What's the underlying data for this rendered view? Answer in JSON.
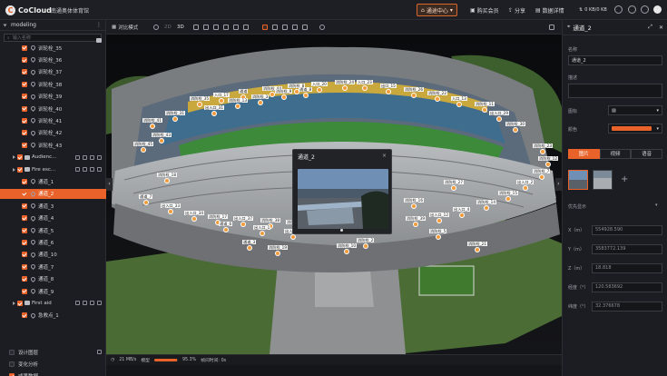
{
  "app": {
    "name": "CoCloud",
    "project_title": "南通奥体体育馆"
  },
  "topbar": {
    "scene_center": "通途中心",
    "buy_package": "购买会员",
    "share": "分享",
    "data_details": "数据详情",
    "network_speed": "0 KB/0 KB"
  },
  "sidebar": {
    "layer_title": "modeling",
    "search_placeholder": "输入名称",
    "rows": [
      {
        "label": "训轮栓_35",
        "kind": "pin",
        "checked": true
      },
      {
        "label": "训轮栓_36",
        "kind": "pin",
        "checked": true
      },
      {
        "label": "训轮栓_37",
        "kind": "pin",
        "checked": true
      },
      {
        "label": "训轮栓_38",
        "kind": "pin",
        "checked": true
      },
      {
        "label": "训轮栓_39",
        "kind": "pin",
        "checked": true
      },
      {
        "label": "训轮栓_40",
        "kind": "pin",
        "checked": true
      },
      {
        "label": "训轮栓_41",
        "kind": "pin",
        "checked": true
      },
      {
        "label": "训轮栓_42",
        "kind": "pin",
        "checked": true
      },
      {
        "label": "训轮栓_43",
        "kind": "pin",
        "checked": true
      },
      {
        "label": "Audienc...",
        "kind": "folder",
        "checked": true
      },
      {
        "label": "Fire esc...",
        "kind": "folder",
        "checked": true
      },
      {
        "label": "通道_1",
        "kind": "pin",
        "checked": true
      },
      {
        "label": "通道_2",
        "kind": "pin",
        "checked": true,
        "selected": true
      },
      {
        "label": "通道_3",
        "kind": "pin",
        "checked": true
      },
      {
        "label": "通道_4",
        "kind": "pin",
        "checked": true
      },
      {
        "label": "通道_5",
        "kind": "pin",
        "checked": true
      },
      {
        "label": "通道_6",
        "kind": "pin",
        "checked": true
      },
      {
        "label": "通道_10",
        "kind": "pin",
        "checked": true
      },
      {
        "label": "通道_7",
        "kind": "pin",
        "checked": true
      },
      {
        "label": "通道_8",
        "kind": "pin",
        "checked": true
      },
      {
        "label": "通道_9",
        "kind": "pin",
        "checked": true
      },
      {
        "label": "First aid",
        "kind": "folder",
        "checked": true
      },
      {
        "label": "急救点_1",
        "kind": "pin",
        "checked": true
      },
      {
        "label": "",
        "kind": "blank",
        "checked": false
      },
      {
        "label": "",
        "kind": "blank",
        "checked": false
      },
      {
        "label": "设计图层",
        "kind": "plain",
        "checked": false
      },
      {
        "label": "变化分析",
        "kind": "plain",
        "checked": false
      },
      {
        "label": "成果数据",
        "kind": "plain",
        "checked": true
      }
    ]
  },
  "view_toolbar": {
    "compare_mode": "对比模式",
    "mode_2d": "2D",
    "mode_3d": "3D"
  },
  "markers": [
    {
      "label": "消防栓_41"
    },
    {
      "label": "消防栓_31"
    },
    {
      "label": "消防栓_35"
    },
    {
      "label": "入口_17"
    },
    {
      "label": "通道"
    },
    {
      "label": "消防栓_44"
    },
    {
      "label": "消防栓_8"
    },
    {
      "label": "入口_20"
    },
    {
      "label": "消防栓_24"
    },
    {
      "label": "入口_23"
    },
    {
      "label": "出口_15"
    },
    {
      "label": "消防栓_26"
    },
    {
      "label": "消防栓_22"
    },
    {
      "label": "入口_13"
    },
    {
      "label": "消防栓_11"
    },
    {
      "label": "消防栓_45"
    },
    {
      "label": "消防栓_43"
    },
    {
      "label": "出入口_29"
    },
    {
      "label": "消防栓_30"
    },
    {
      "label": "出入口_31"
    },
    {
      "label": "消防栓_13"
    },
    {
      "label": "消防栓_3"
    },
    {
      "label": "消防栓_9"
    },
    {
      "label": "通道_8"
    },
    {
      "label": "通道_7"
    },
    {
      "label": "出入口_33"
    },
    {
      "label": "出入口_34"
    },
    {
      "label": "消防栓_17"
    },
    {
      "label": "出入口_37"
    },
    {
      "label": "消防栓_38"
    },
    {
      "label": "消防栓_42"
    },
    {
      "label": "消防栓_39"
    },
    {
      "label": "出入口_12"
    },
    {
      "label": "出入口_4"
    },
    {
      "label": "消防栓_14"
    },
    {
      "label": "消防栓_15"
    },
    {
      "label": "出入口_2"
    },
    {
      "label": "消防栓_7"
    },
    {
      "label": "消防栓_18"
    },
    {
      "label": "通道_6"
    },
    {
      "label": "出入口_1"
    },
    {
      "label": "出入口_3"
    },
    {
      "label": "通道_3"
    },
    {
      "label": "消防栓_19"
    },
    {
      "label": "消防栓_20"
    },
    {
      "label": "消防栓_16"
    },
    {
      "label": "通道_1"
    },
    {
      "label": "消防栓_2"
    },
    {
      "label": "消防栓_10"
    },
    {
      "label": "消防栓_5"
    },
    {
      "label": "消防栓_21"
    },
    {
      "label": "消防栓_27"
    },
    {
      "label": "消防栓_23"
    },
    {
      "label": "消防栓_12"
    }
  ],
  "popup": {
    "title": "通道_2",
    "close": "×"
  },
  "statusbar": {
    "speed": "21 MB/s",
    "loading_label": "模型",
    "percent": "95.3%",
    "progress": 0.953,
    "frame_label": "帧间时间: 0s"
  },
  "right_panel": {
    "title": "通道_2",
    "name_label": "名称",
    "name_value": "通道_2",
    "desc_label": "描述",
    "icon_label": "图标",
    "color_label": "颜色",
    "color_value": "#e8622a",
    "tabs": [
      "图片",
      "视频",
      "语音"
    ],
    "priority_label": "优先显示",
    "coords": [
      {
        "k": "X（m）",
        "v": "554928.590"
      },
      {
        "k": "Y（m）",
        "v": "3583772.139"
      },
      {
        "k": "Z（m）",
        "v": "18.818"
      },
      {
        "k": "经度（°）",
        "v": "120.583692"
      },
      {
        "k": "纬度（°）",
        "v": "32.376678"
      }
    ]
  }
}
